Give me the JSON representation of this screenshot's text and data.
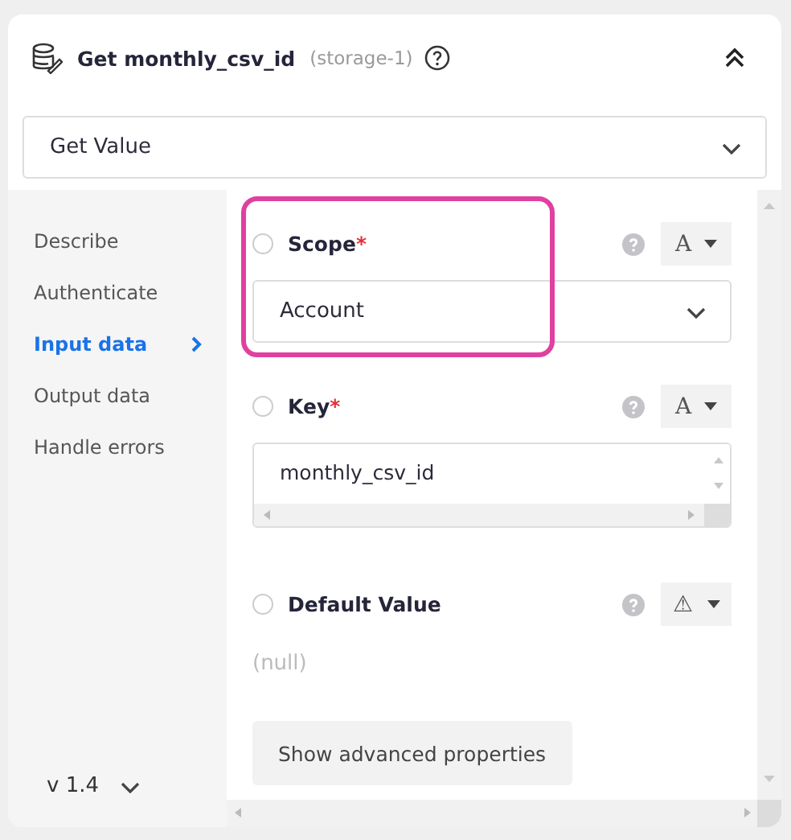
{
  "header": {
    "title": "Get monthly_csv_id",
    "subtitle": "(storage-1)",
    "expanded": true
  },
  "action_select": {
    "value": "Get Value"
  },
  "sidebar": {
    "items": [
      {
        "label": "Describe",
        "selected": false
      },
      {
        "label": "Authenticate",
        "selected": false
      },
      {
        "label": "Input data",
        "selected": true
      },
      {
        "label": "Output data",
        "selected": false
      },
      {
        "label": "Handle errors",
        "selected": false
      }
    ],
    "version": "v 1.4"
  },
  "fields": [
    {
      "kind": "select",
      "label": "Scope",
      "required_mark": "*",
      "highlighted": true,
      "checked": false,
      "type_glyph": "A",
      "value": "Account"
    },
    {
      "kind": "textarea",
      "label": "Key",
      "required_mark": "*",
      "highlighted": false,
      "checked": false,
      "type_glyph": "A",
      "value": "monthly_csv_id"
    },
    {
      "kind": "empty",
      "label": "Default Value",
      "highlighted": false,
      "checked": false,
      "type_glyph": "⚠",
      "value": "(null)"
    }
  ],
  "advanced_button": "Show advanced properties"
}
